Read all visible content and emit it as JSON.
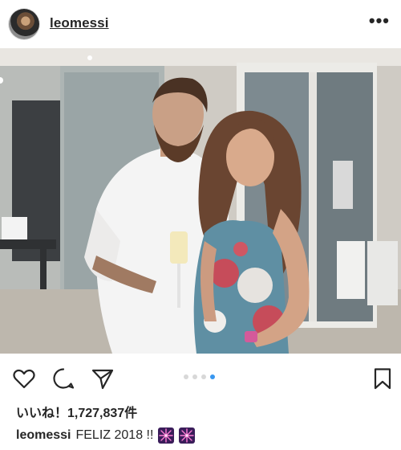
{
  "post": {
    "username": "leomessi",
    "more_icon": "more-horizontal-icon",
    "likes_text": "いいね！1,727,837件",
    "caption_user": "leomessi",
    "caption_text": "FELIZ 2018 !!",
    "caption_emojis": [
      "fireworks-emoji",
      "fireworks-emoji"
    ],
    "carousel": {
      "total": 4,
      "active_index": 3
    }
  },
  "actions": {
    "like_icon": "heart-icon",
    "comment_icon": "comment-icon",
    "share_icon": "send-icon",
    "save_icon": "bookmark-icon"
  },
  "colors": {
    "carousel_active": "#3897f0",
    "carousel_inactive": "#d8d8d8",
    "text": "#262626"
  }
}
